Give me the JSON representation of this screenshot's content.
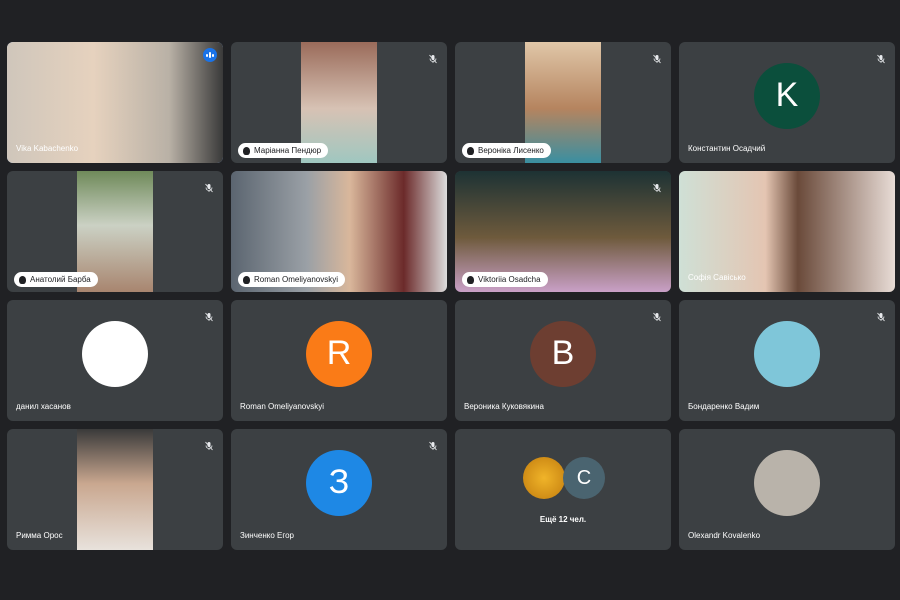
{
  "colors": {
    "background": "#202124",
    "tile": "#3c4043",
    "active": "#8ab4f8"
  },
  "tiles": [
    {
      "name": "Vika Kabachenko",
      "type": "video",
      "speaking": true,
      "video": "linear-gradient(90deg,#cfc6bb,#e6d2be 40%,#b9b1a6 75%,#3a3a3a)"
    },
    {
      "name": "Маріанна Пендюр",
      "type": "video",
      "muted": true,
      "video": "linear-gradient(180deg,#9a6b5a,#d7c2b4 55%,#9fc7c0)"
    },
    {
      "name": "Вероніка Лисенко",
      "type": "video",
      "muted": true,
      "video": "linear-gradient(180deg,#e0c7a8,#b5845f 55%,#3a8fa1)"
    },
    {
      "name": "Константин Осадчий",
      "type": "avatar",
      "letter": "K",
      "avatar_color": "#0b4f3c",
      "muted": true
    },
    {
      "name": "Анатолий Барба",
      "type": "video",
      "muted": true,
      "video": "linear-gradient(180deg,#6f8a5a,#cbd1c4 45%,#a8856f)"
    },
    {
      "name": "Roman Omeliyanovskyi",
      "type": "video",
      "video": "linear-gradient(90deg,#5b6570,#9aa0a6 35%,#d9b79b 55%,#6b2a2a 80%,#ddd)",
      "full": true
    },
    {
      "name": "Viktoriia Osadcha",
      "type": "video",
      "muted": true,
      "video": "linear-gradient(180deg,#1d3234,#6e5a3c 55%,#c9a0c7)",
      "full": true
    },
    {
      "name": "Софія Савісько",
      "type": "video",
      "video": "linear-gradient(90deg,#cfe0d6,#e4c5b2 40%,#6a4a3a 55%,#e8dcd6)",
      "full": true,
      "plain_label": true
    },
    {
      "name": "данил хасанов",
      "type": "avatar",
      "letter": "",
      "avatar_color": "#ffffff",
      "muted": true
    },
    {
      "name": "Roman Omeliyanovskyi",
      "type": "avatar",
      "letter": "R",
      "avatar_color": "#fa7b17"
    },
    {
      "name": "Вероника Куковякина",
      "type": "avatar",
      "letter": "B",
      "avatar_color": "#6d3e31",
      "muted": true
    },
    {
      "name": "Бондаренко Вадим",
      "type": "avatar",
      "letter": "",
      "avatar_color": "#7fc6d9",
      "muted": true
    },
    {
      "name": "Римма Орос",
      "type": "video",
      "muted": true,
      "video": "linear-gradient(180deg,#3a3a3a,#c9a78f 45%,#e8e2dc)",
      "plain_label": true
    },
    {
      "name": "Зинченко Егор",
      "type": "avatar",
      "letter": "З",
      "avatar_color": "#1e88e5",
      "muted": true
    },
    {
      "name": "",
      "type": "more",
      "more_label": "Ещё 12 чел.",
      "letter": "С",
      "avatar_color": "#4a6470"
    },
    {
      "name": "Olexandr Kovalenko",
      "type": "avatar",
      "letter": "",
      "avatar_color": "#b9b3aa"
    }
  ]
}
